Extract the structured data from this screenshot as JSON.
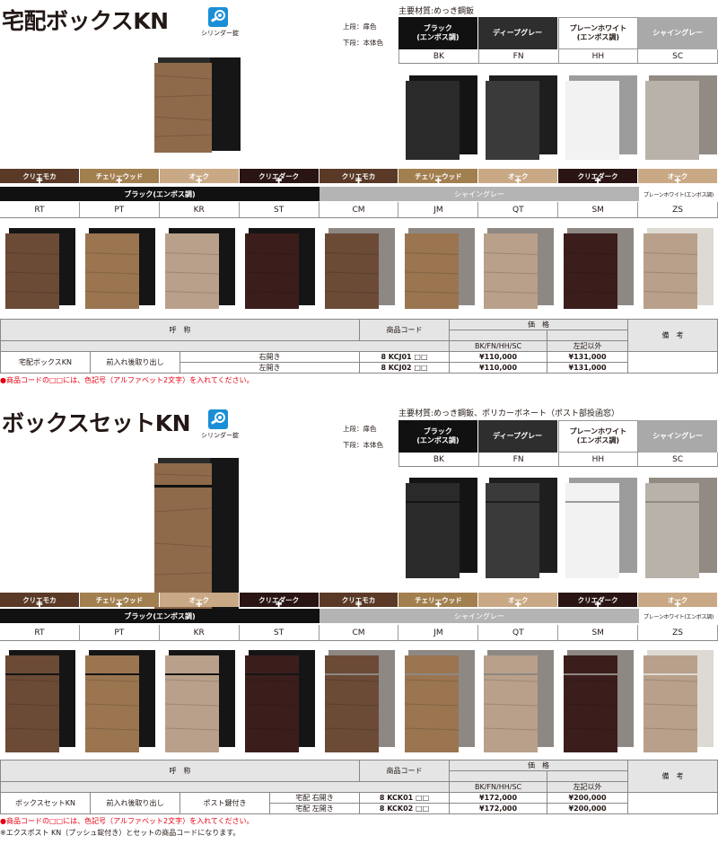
{
  "section1": {
    "title": "宅配ボックスKN",
    "key_label": "シリンダー錠",
    "upper_note": "上段：扉色",
    "lower_note": "下段：本体色",
    "material": "主要材質:めっき鋼鈑",
    "colors": [
      {
        "name": "ブラック\n(エンボス調)",
        "code": "BK"
      },
      {
        "name": "ディープグレー",
        "code": "FN"
      },
      {
        "name": "プレーンホワイト\n(エンボス調)",
        "code": "HH"
      },
      {
        "name": "シャイングレー",
        "code": "SC"
      }
    ],
    "doors": [
      "クリエモカ",
      "チェリーウッド",
      "オーク",
      "クリエダーク",
      "クリエモカ",
      "チェリーウッド",
      "オーク",
      "クリエダーク",
      "オーク"
    ],
    "plus": "✚",
    "base_black": "ブラック(エンボス調)",
    "base_shine": "シャイングレー",
    "base_white": "プレーンホワイト(エンボス調)",
    "codes": [
      "RT",
      "PT",
      "KR",
      "ST",
      "CM",
      "JM",
      "QT",
      "SM",
      "ZS"
    ],
    "table": {
      "h_name": "呼　称",
      "h_code": "商品コード",
      "h_price": "価　格",
      "h_remarks": "備　考",
      "h_sub1": "BK/FN/HH/SC",
      "h_sub2": "左記以外",
      "product": "宅配ボックスKN",
      "type": "前入れ後取り出し",
      "rows": [
        {
          "side": "右開き",
          "code": "8 KCJ01 □□",
          "p1": "¥110,000",
          "p2": "¥131,000"
        },
        {
          "side": "左開き",
          "code": "8 KCJ02 □□",
          "p1": "¥110,000",
          "p2": "¥131,000"
        }
      ]
    },
    "red_note": "●商品コードの□□には、色記号（アルファベット2文字）を入れてください。"
  },
  "section2": {
    "title": "ボックスセットKN",
    "key_label": "シリンダー錠",
    "upper_note": "上段：扉色",
    "lower_note": "下段：本体色",
    "material": "主要材質:めっき鋼鈑、ポリカーボネート（ポスト部投函窓）",
    "colors": [
      {
        "name": "ブラック\n(エンボス調)",
        "code": "BK"
      },
      {
        "name": "ディープグレー",
        "code": "FN"
      },
      {
        "name": "プレーンホワイト\n(エンボス調)",
        "code": "HH"
      },
      {
        "name": "シャイングレー",
        "code": "SC"
      }
    ],
    "doors": [
      "クリエモカ",
      "チェリーウッド",
      "オーク",
      "クリエダーク",
      "クリエモカ",
      "チェリーウッド",
      "オーク",
      "クリエダーク",
      "オーク"
    ],
    "plus": "✚",
    "base_black": "ブラック(エンボス調)",
    "base_shine": "シャイングレー",
    "base_white": "プレーンホワイト(エンボス調)",
    "codes": [
      "RT",
      "PT",
      "KR",
      "ST",
      "CM",
      "JM",
      "QT",
      "SM",
      "ZS"
    ],
    "table": {
      "h_name": "呼　称",
      "h_code": "商品コード",
      "h_price": "価　格",
      "h_remarks": "備　考",
      "h_sub1": "BK/FN/HH/SC",
      "h_sub2": "左記以外",
      "product": "ボックスセットKN",
      "type": "前入れ後取り出し",
      "lock": "ポスト鍵付き",
      "rows": [
        {
          "side": "宅配 右開き",
          "code": "8 KCK01 □□",
          "p1": "¥172,000",
          "p2": "¥200,000"
        },
        {
          "side": "宅配 左開き",
          "code": "8 KCK02 □□",
          "p1": "¥172,000",
          "p2": "¥200,000"
        }
      ]
    },
    "red_note": "●商品コードの□□には、色記号（アルファベット2文字）を入れてください。",
    "foot_note": "※エクスポスト KN（プッシュ錠付き）とセットの商品コードになります。"
  },
  "palette": {
    "door_colors": [
      "#6b4a36",
      "#9a7550",
      "#b9a08a",
      "#3b1e1c",
      "#6b4a36",
      "#9a7550",
      "#b9a08a",
      "#3b1e1c",
      "#b9a08a"
    ],
    "door_header_colors": [
      "#5a3a26",
      "#a27f4f",
      "#c9a985",
      "#2a1414",
      "#5a3a26",
      "#a27f4f",
      "#c9a985",
      "#2a1414",
      "#c9a985"
    ],
    "body_colors": [
      "#151515",
      "#151515",
      "#151515",
      "#151515",
      "#8d8883",
      "#8d8883",
      "#8d8883",
      "#8d8883",
      "#ddd9d3"
    ],
    "solid_colors": [
      "#2a2a2a",
      "#3a3a3a",
      "#f2f2f2",
      "#b9b2aa"
    ],
    "solid_side": [
      "#141414",
      "#1e1e1e",
      "#9c9c9c",
      "#928b83"
    ],
    "red": "#e60012"
  }
}
